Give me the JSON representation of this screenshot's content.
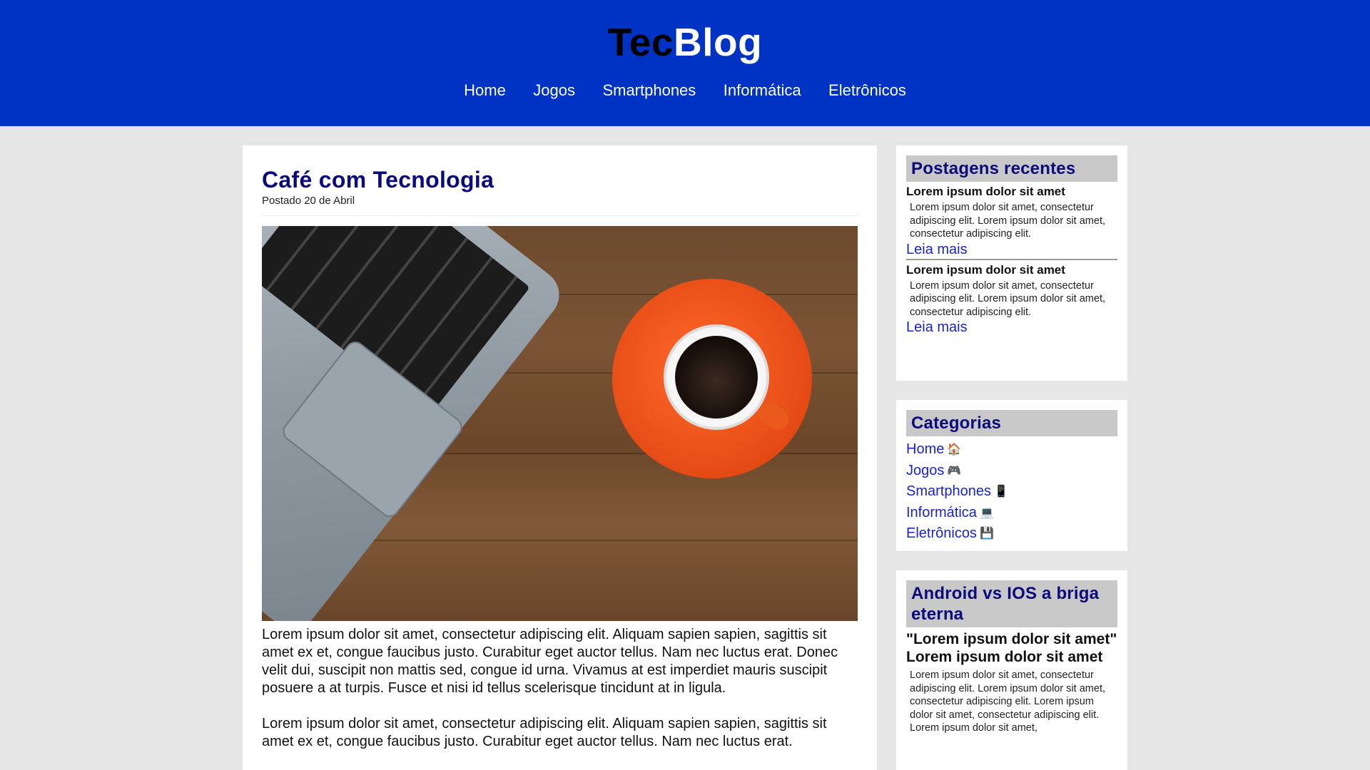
{
  "header": {
    "brand_part1": "Tec",
    "brand_part2": "Blog",
    "nav": [
      "Home",
      "Jogos",
      "Smartphones",
      "Informática",
      "Eletrônicos"
    ]
  },
  "post": {
    "title": "Café com Tecnologia",
    "date": "Postado 20 de Abril",
    "image_alt": "notebook e xícara de café sobre mesa de madeira",
    "paragraphs": [
      "Lorem ipsum dolor sit amet, consectetur adipiscing elit. Aliquam sapien sapien, sagittis sit amet ex et, congue faucibus justo. Curabitur eget auctor tellus. Nam nec luctus erat. Donec velit dui, suscipit non mattis sed, congue id urna. Vivamus at est imperdiet mauris suscipit posuere a at turpis. Fusce et nisi id tellus scelerisque tincidunt at in ligula.",
      "Lorem ipsum dolor sit amet, consectetur adipiscing elit. Aliquam sapien sapien, sagittis sit amet ex et, congue faucibus justo. Curabitur eget auctor tellus. Nam nec luctus erat."
    ]
  },
  "recent": {
    "title": "Postagens recentes",
    "items": [
      {
        "heading": "Lorem ipsum dolor sit amet",
        "excerpt": "Lorem ipsum dolor sit amet, consectetur adipiscing elit. Lorem ipsum dolor sit amet, consectetur adipiscing elit.",
        "link": "Leia mais"
      },
      {
        "heading": "Lorem ipsum dolor sit amet",
        "excerpt": "Lorem ipsum dolor sit amet, consectetur adipiscing elit. Lorem ipsum dolor sit amet, consectetur adipiscing elit.",
        "link": "Leia mais"
      }
    ]
  },
  "categories": {
    "title": "Categorias",
    "items": [
      {
        "label": "Home",
        "icon": "🏠",
        "icon_name": "house-icon"
      },
      {
        "label": "Jogos",
        "icon": "🎮",
        "icon_name": "gamepad-icon"
      },
      {
        "label": "Smartphones",
        "icon": "📱",
        "icon_name": "smartphone-icon"
      },
      {
        "label": "Informática",
        "icon": "💻",
        "icon_name": "laptop-icon"
      },
      {
        "label": "Eletrônicos",
        "icon": "💾",
        "icon_name": "floppy-disk-icon"
      }
    ]
  },
  "featured": {
    "title": "Android vs IOS a briga eterna",
    "heading": "\"Lorem ipsum dolor sit amet\" Lorem ipsum dolor sit amet",
    "excerpt": "Lorem ipsum dolor sit amet, consectetur adipiscing elit. Lorem ipsum dolor sit amet, consectetur adipiscing elit. Lorem ipsum dolor sit amet, consectetur adipiscing elit. Lorem ipsum dolor sit amet,"
  },
  "colors": {
    "header_bg": "#0033c4",
    "title_color": "#0a0a7d",
    "link_color": "#1a25c9",
    "page_bg": "#e6e6e6"
  }
}
